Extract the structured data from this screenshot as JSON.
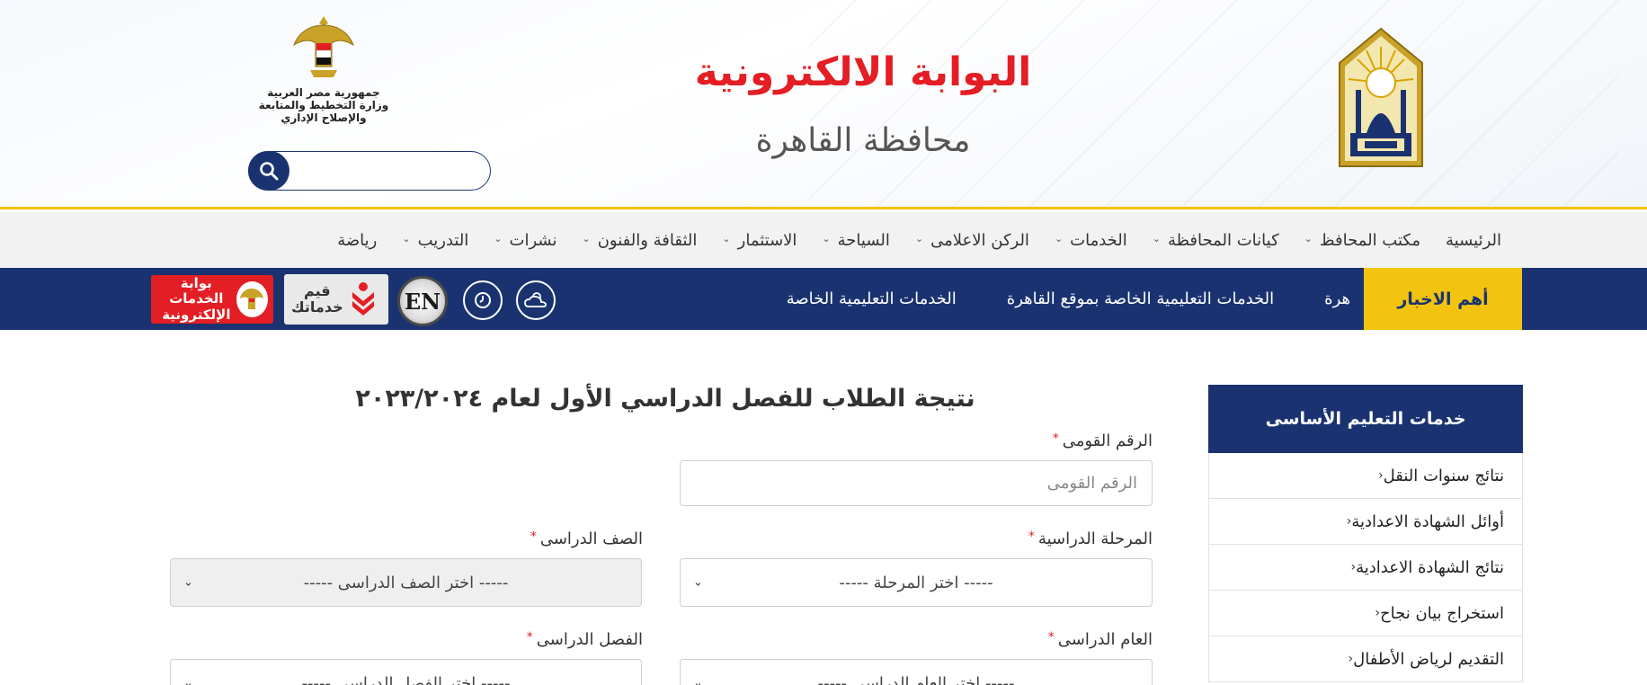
{
  "header": {
    "title_main": "البوابة الالكترونية",
    "title_sub": "محافظة القاهرة",
    "emblem_line1": "جمهورية مصر العربية",
    "emblem_line2": "وزارة التخطيط والمتابعة والإصلاح الإداري",
    "search_placeholder": ""
  },
  "main_nav": {
    "items": [
      {
        "label": "الرئيسية",
        "has_dropdown": false
      },
      {
        "label": "مكتب المحافظ",
        "has_dropdown": true
      },
      {
        "label": "كيانات المحافظة",
        "has_dropdown": true
      },
      {
        "label": "الخدمات",
        "has_dropdown": true
      },
      {
        "label": "الركن الاعلامى",
        "has_dropdown": true
      },
      {
        "label": "السياحة",
        "has_dropdown": true
      },
      {
        "label": "الاستثمار",
        "has_dropdown": true
      },
      {
        "label": "الثقافة والفنون",
        "has_dropdown": true
      },
      {
        "label": "نشرات",
        "has_dropdown": true
      },
      {
        "label": "التدريب",
        "has_dropdown": true
      },
      {
        "label": "رياضة",
        "has_dropdown": false
      }
    ]
  },
  "news_bar": {
    "label": "أهم الاخبار",
    "ticker": [
      "هرة",
      "الخدمات التعليمية الخاصة بموقع القاهرة",
      "الخدمات التعليمية الخاصة"
    ],
    "en_label": "EN",
    "qayyem_label_1": "قيم",
    "qayyem_label_2": "خدماتك",
    "eservices_label_1": "بوابة الخدمات",
    "eservices_label_2": "الإلكترونية"
  },
  "sidebar": {
    "title": "خدمات التعليم الأساسى",
    "items": [
      "نتائج سنوات النقل",
      "أوائل الشهادة الاعدادية",
      "نتائج الشهادة الاعدادية",
      "استخراج بيان نجاح",
      "التقديم لرياض الأطفال"
    ]
  },
  "form": {
    "title": "نتيجة الطلاب للفصل الدراسي الأول لعام ٢٠٢٣/٢٠٢٤",
    "national_id_label": "الرقم القومى",
    "national_id_placeholder": "الرقم القومى",
    "stage_label": "المرحلة الدراسية",
    "stage_value": "----- اختر المرحلة -----",
    "grade_label": "الصف الدراسى",
    "grade_value": "----- اختر الصف الدراسى -----",
    "year_label": "العام الدراسى",
    "year_value": "----- اختر العام الدراسى -----",
    "term_label": "الفصل الدراسى",
    "term_value": "----- اختر الفصل الدراسى -----",
    "required_mark": "*"
  },
  "colors": {
    "navy": "#1a3370",
    "red": "#e31e24",
    "yellow": "#f2c40f"
  }
}
